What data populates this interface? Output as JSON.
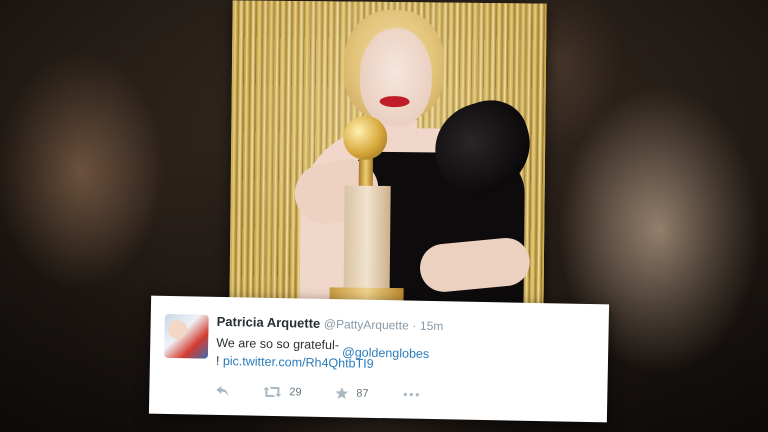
{
  "tweet": {
    "display_name": "Patricia Arquette",
    "handle": "@PattyArquette",
    "separator": "·",
    "time": "15m",
    "text": "We are so so grateful-",
    "mention": "@goldenglobes",
    "text_prefix": "!",
    "link": "pic.twitter.com/Rh4QhtbTI9",
    "retweet_count": "29",
    "favorite_count": "87"
  },
  "icons": {
    "reply": "reply-icon",
    "retweet": "retweet-icon",
    "favorite": "star-icon",
    "more": "more-icon"
  },
  "colors": {
    "link": "#2b7bb9",
    "name": "#292f33",
    "meta": "#8899a6"
  }
}
